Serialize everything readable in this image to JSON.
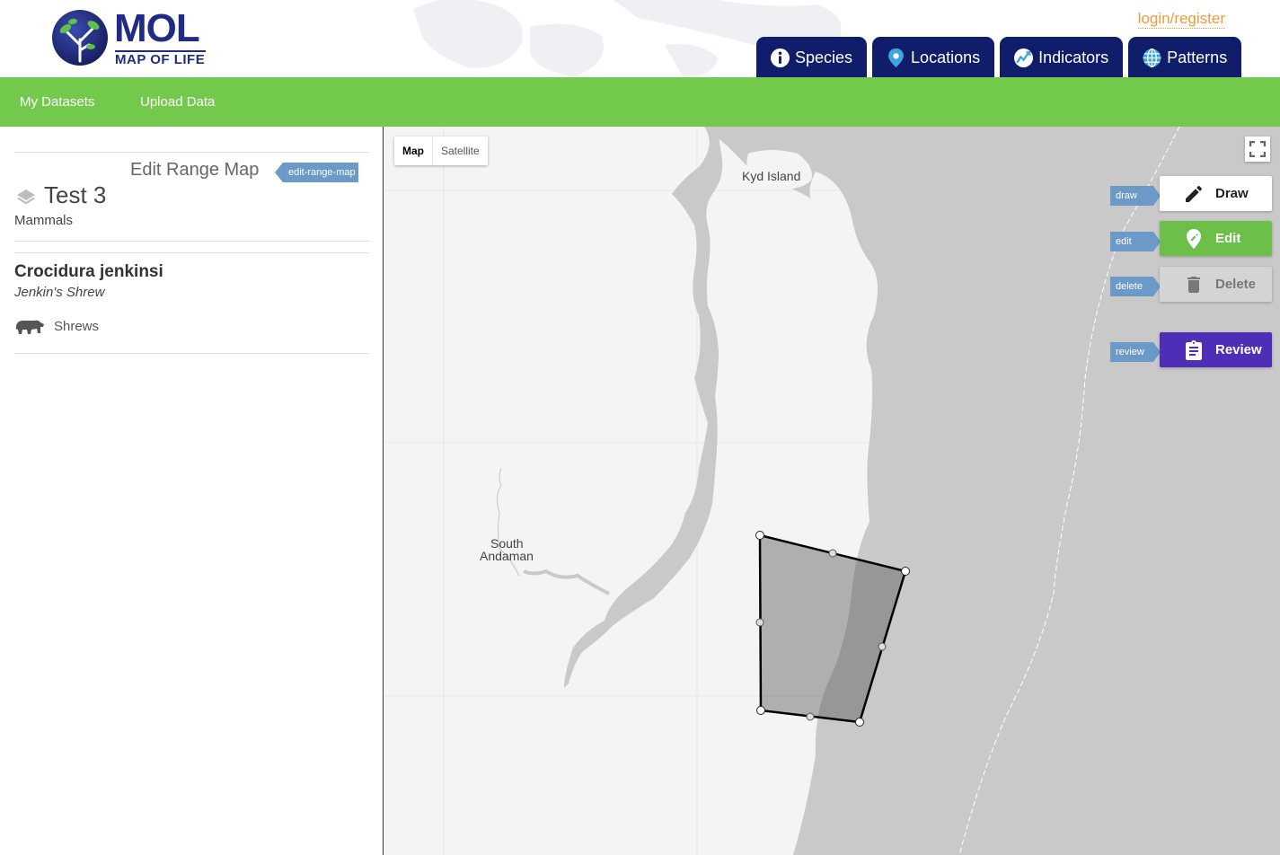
{
  "header": {
    "logo_main": "MOL",
    "logo_sub": "MAP OF LIFE",
    "login": "login/register",
    "tabs": [
      {
        "label": "Species",
        "icon": "info-icon"
      },
      {
        "label": "Locations",
        "icon": "location-pin-icon"
      },
      {
        "label": "Indicators",
        "icon": "trend-chart-icon"
      },
      {
        "label": "Patterns",
        "icon": "globe-icon"
      }
    ]
  },
  "subnav": {
    "my_datasets": "My Datasets",
    "upload_data": "Upload Data"
  },
  "panel": {
    "heading": "Edit Range Map",
    "heading_tag": "edit-range-map",
    "dataset_title": "Test 3",
    "dataset_group": "Mammals",
    "species_name": "Crocidura jenkinsi",
    "common_name": "Jenkin's Shrew",
    "species_group": "Shrews"
  },
  "map": {
    "type_map": "Map",
    "type_satellite": "Satellite",
    "labels": {
      "kyd_island": "Kyd Island",
      "south_andaman_1": "South",
      "south_andaman_2": "Andaman"
    }
  },
  "tools": {
    "draw": {
      "tag": "draw",
      "label": "Draw",
      "icon": "pencil-icon"
    },
    "edit": {
      "tag": "edit",
      "label": "Edit",
      "icon": "edit-pin-icon"
    },
    "delete": {
      "tag": "delete",
      "label": "Delete",
      "icon": "trash-icon"
    },
    "review": {
      "tag": "review",
      "label": "Review",
      "icon": "clipboard-icon"
    }
  },
  "colors": {
    "nav_tab": "#0f1d6a",
    "green_bar": "#73c94b",
    "login": "#f09a3e",
    "edit_button": "#6cc04a",
    "review_button": "#4f2eb7",
    "tag": "#6b9ac8"
  }
}
